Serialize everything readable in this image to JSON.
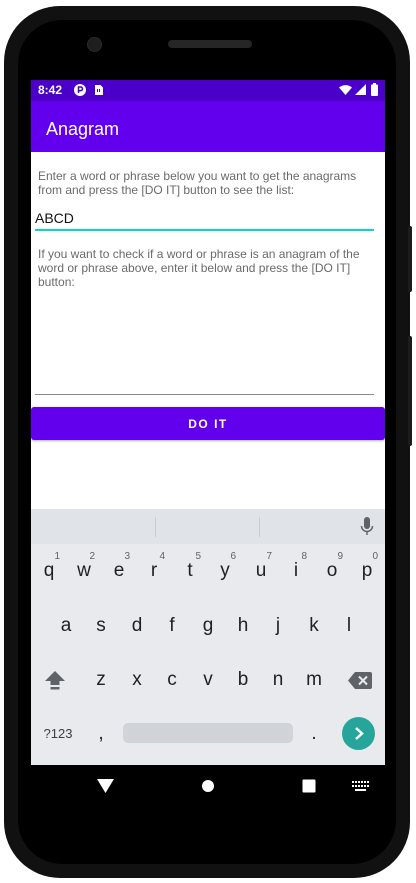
{
  "status_bar": {
    "time": "8:42",
    "icons_left": [
      "notification-p-icon",
      "sim-card-icon"
    ],
    "icons_right": [
      "wifi-icon",
      "signal-icon",
      "battery-icon"
    ]
  },
  "app_bar": {
    "title": "Anagram"
  },
  "main": {
    "instruction_1": "Enter a word or phrase below you want to get the anagrams from and press the [DO IT] button to see the list:",
    "word_input_value": "ABCD",
    "instruction_2": "If you want to check if a word or phrase is an anagram of the word or phrase above, enter it below and press the [DO IT] button:",
    "check_input_value": "",
    "do_it_label": "DO IT"
  },
  "keyboard": {
    "row1": [
      "q",
      "w",
      "e",
      "r",
      "t",
      "y",
      "u",
      "i",
      "o",
      "p"
    ],
    "row1_hints": [
      "1",
      "2",
      "3",
      "4",
      "5",
      "6",
      "7",
      "8",
      "9",
      "0"
    ],
    "row2": [
      "a",
      "s",
      "d",
      "f",
      "g",
      "h",
      "j",
      "k",
      "l"
    ],
    "row3": [
      "z",
      "x",
      "c",
      "v",
      "b",
      "n",
      "m"
    ],
    "symbols_label": "?123",
    "comma_label": ",",
    "period_label": "."
  },
  "colors": {
    "primary": "#6200ee",
    "status_bar": "#4a00c9",
    "accent": "#03dac5",
    "enter_key": "#26a69a"
  }
}
